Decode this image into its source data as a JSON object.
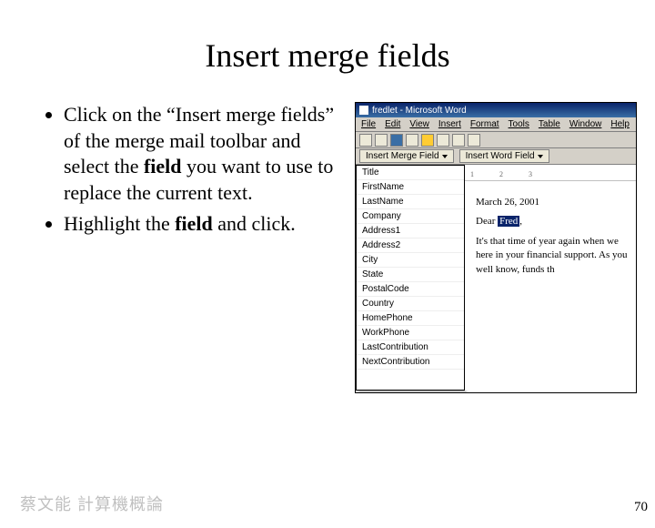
{
  "title": "Insert merge fields",
  "bullets": [
    {
      "pre": "Click on the “Insert merge fields” of the merge mail toolbar and select the ",
      "bold": "field",
      "post": " you want to use to replace the current text."
    },
    {
      "pre": "Highlight the ",
      "bold": "field",
      "post": " and click."
    }
  ],
  "word": {
    "titlebar": "fredlet - Microsoft Word",
    "menus": [
      "File",
      "Edit",
      "View",
      "Insert",
      "Format",
      "Tools",
      "Table",
      "Window",
      "Help"
    ],
    "mergebar": {
      "insertMerge": "Insert Merge Field",
      "insertWord": "Insert Word Field"
    },
    "ruler": [
      "1",
      "2",
      "3"
    ],
    "fields": [
      "Title",
      "FirstName",
      "LastName",
      "Company",
      "Address1",
      "Address2",
      "City",
      "State",
      "PostalCode",
      "Country",
      "HomePhone",
      "WorkPhone",
      "LastContribution",
      "NextContribution"
    ],
    "doc": {
      "date": "March 26, 2001",
      "greetingPre": "Dear ",
      "greetingName": "Fred",
      "greetingPost": ",",
      "para": "It's that time of year again when we here in your financial support. As you well know, funds th"
    }
  },
  "footer": {
    "author": "蔡文能 計算機概論",
    "page": "70"
  }
}
